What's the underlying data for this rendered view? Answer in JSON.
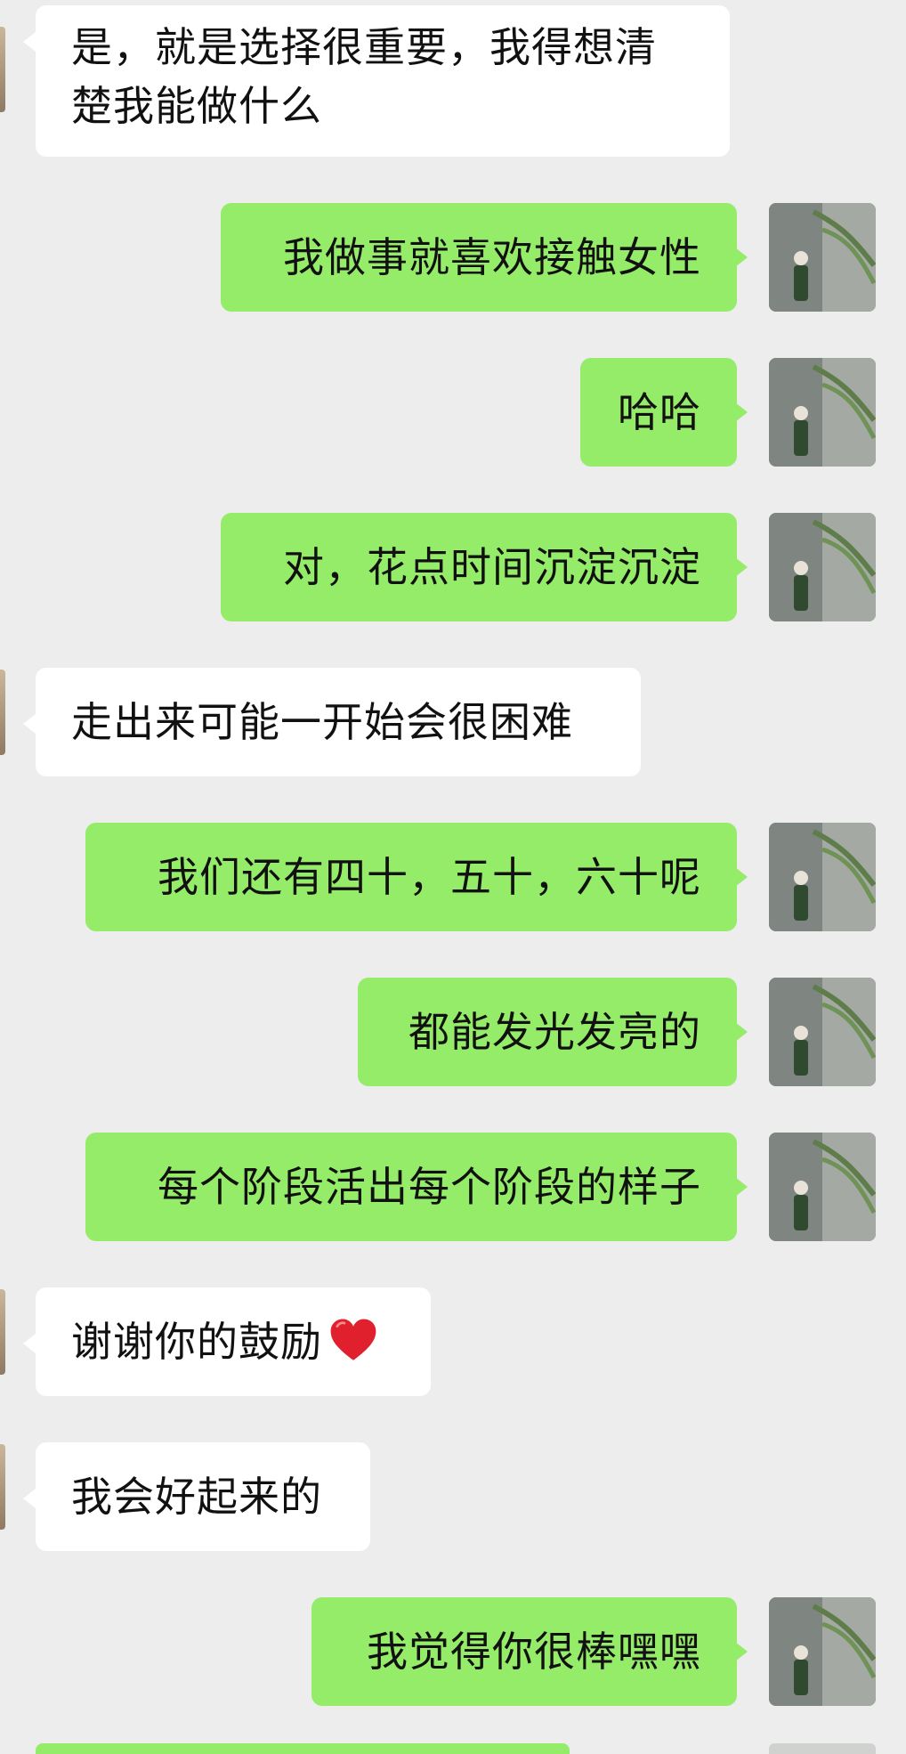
{
  "colors": {
    "background": "#ededed",
    "outgoing_bubble": "#95ec69",
    "incoming_bubble": "#ffffff",
    "text": "#111111"
  },
  "messages": [
    {
      "id": "m1",
      "side": "in",
      "text": "是，就是选择很重要，我得想清楚我能做什么"
    },
    {
      "id": "m2",
      "side": "out",
      "text": "我做事就喜欢接触女性"
    },
    {
      "id": "m3",
      "side": "out",
      "text": "哈哈"
    },
    {
      "id": "m4",
      "side": "out",
      "text": "对，花点时间沉淀沉淀"
    },
    {
      "id": "m5",
      "side": "in",
      "text": "走出来可能一开始会很困难"
    },
    {
      "id": "m6",
      "side": "out",
      "text": "我们还有四十，五十，六十呢"
    },
    {
      "id": "m7",
      "side": "out",
      "text": "都能发光发亮的"
    },
    {
      "id": "m8",
      "side": "out",
      "text": "每个阶段活出每个阶段的样子"
    },
    {
      "id": "m9",
      "side": "in",
      "text": "谢谢你的鼓励",
      "emoji": "red-heart"
    },
    {
      "id": "m10",
      "side": "in",
      "text": "我会好起来的"
    },
    {
      "id": "m11",
      "side": "out",
      "text": "我觉得你很棒嘿嘿"
    }
  ]
}
